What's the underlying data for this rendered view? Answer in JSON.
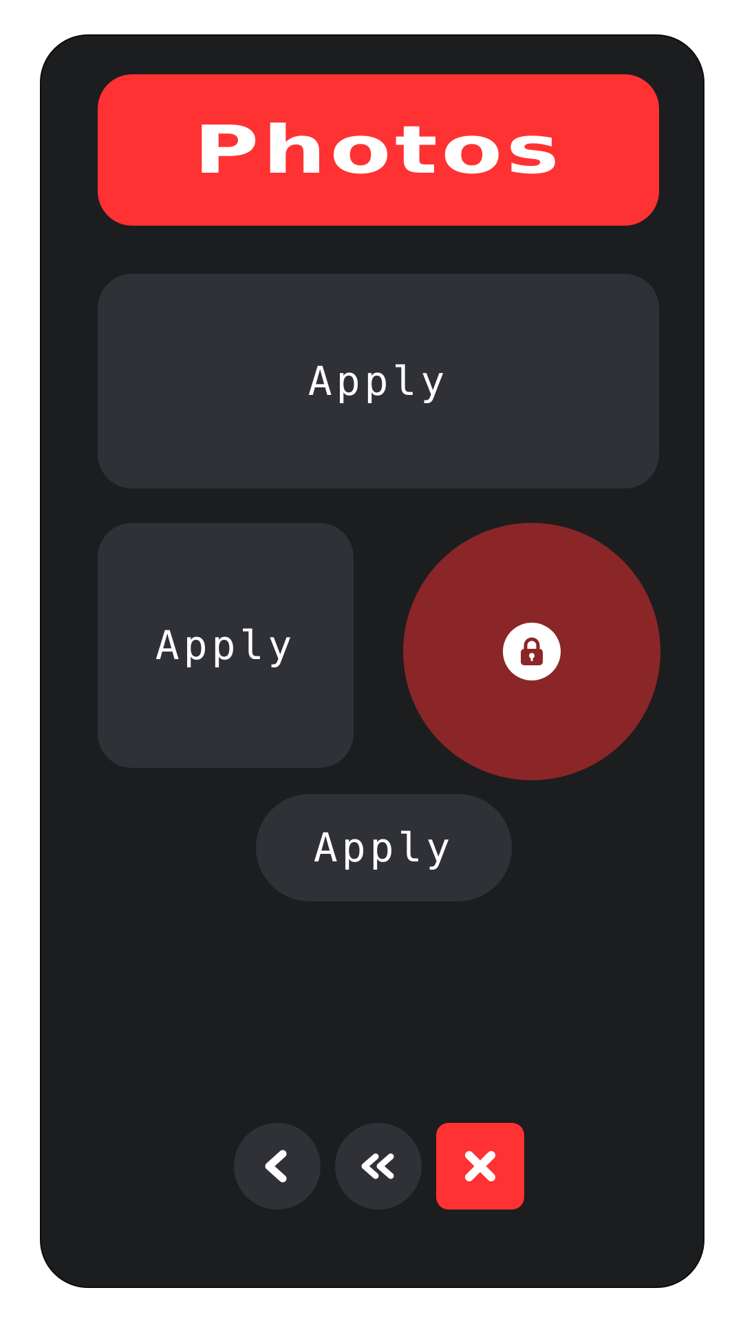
{
  "header": {
    "title": "Photos"
  },
  "panels": {
    "large_label": "Apply",
    "square_label": "Apply",
    "pill_label": "Apply"
  },
  "icons": {
    "lock": "lock-icon",
    "back": "chevron-left-icon",
    "first": "double-chevron-left-icon",
    "close": "close-icon"
  },
  "colors": {
    "device_bg": "#1c1d1f",
    "accent_red": "#ff3233",
    "lock_bg": "#8b2628",
    "panel_bg": "#303137",
    "text": "#ffffff"
  }
}
